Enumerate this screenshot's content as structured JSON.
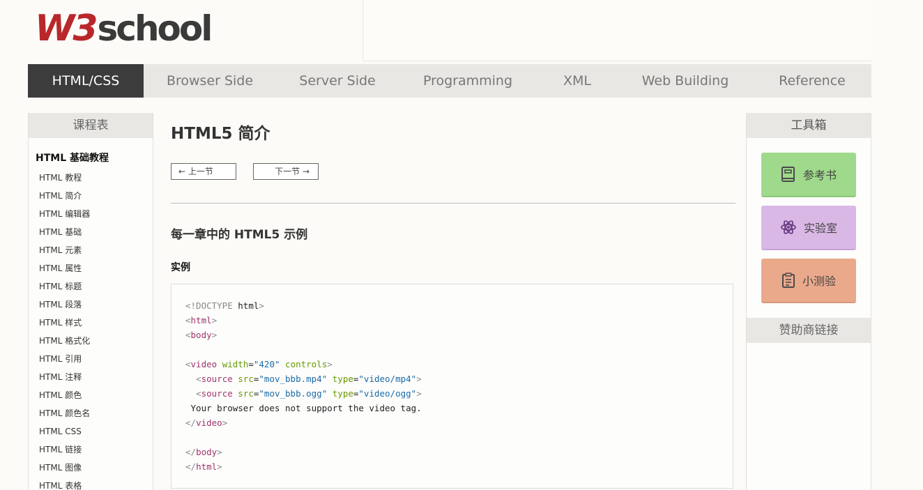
{
  "logo": {
    "brand_w3": "W3",
    "brand_school": "school"
  },
  "nav": [
    {
      "label": "HTML/CSS",
      "active": true
    },
    {
      "label": "Browser Side"
    },
    {
      "label": "Server Side"
    },
    {
      "label": "Programming"
    },
    {
      "label": "XML"
    },
    {
      "label": "Web Building"
    },
    {
      "label": "Reference"
    }
  ],
  "left": {
    "heading": "课程表",
    "section_title": "HTML 基础教程",
    "items": [
      "HTML 教程",
      "HTML 简介",
      "HTML 编辑器",
      "HTML 基础",
      "HTML 元素",
      "HTML 属性",
      "HTML 标题",
      "HTML 段落",
      "HTML 样式",
      "HTML 格式化",
      "HTML 引用",
      "HTML 注释",
      "HTML 颜色",
      "HTML 颜色名",
      "HTML CSS",
      "HTML 链接",
      "HTML 图像",
      "HTML 表格"
    ]
  },
  "main": {
    "title": "HTML5 简介",
    "prev_label": "上一节",
    "next_label": "下一节",
    "section_heading": "每一章中的 HTML5 示例",
    "example_label": "实例",
    "code_lines": [
      "<!DOCTYPE html>",
      "<html>",
      "<body>",
      "",
      "<video width=\"420\" controls>",
      "  <source src=\"mov_bbb.mp4\" type=\"video/mp4\">",
      "  <source src=\"mov_bbb.ogg\" type=\"video/ogg\">",
      " Your browser does not support the video tag.",
      "</video>",
      "",
      "</body>",
      "</html>"
    ]
  },
  "right": {
    "heading": "工具箱",
    "tools": [
      {
        "label": "参考书",
        "icon": "book-icon",
        "color": "#9fd98b"
      },
      {
        "label": "实验室",
        "icon": "atom-icon",
        "color": "#dab8e6"
      },
      {
        "label": "小测验",
        "icon": "clipboard-icon",
        "color": "#eba98b"
      }
    ],
    "sponsor_heading": "赞助商链接"
  }
}
